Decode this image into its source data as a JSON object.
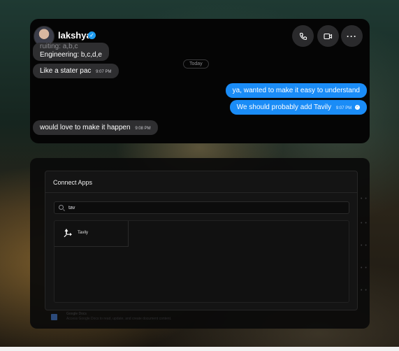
{
  "chat": {
    "contact_name": "lakshya",
    "header_buttons": [
      "phone-icon",
      "video-icon",
      "more-icon"
    ],
    "more_label": "···",
    "messages": [
      {
        "side": "in",
        "text": "Engineering: b,c,d,e",
        "partial_above": "ruiting: a,b,c"
      },
      {
        "side": "in",
        "text": "Like a stater pac",
        "time": "9:07 PM"
      },
      {
        "side": "out",
        "text": "ya, wanted to make it easy to understand"
      },
      {
        "side": "out",
        "text": "We should probably add Tavily",
        "time": "9:07 PM"
      },
      {
        "side": "in",
        "text": "would love to make it happen",
        "time": "9:08 PM"
      }
    ],
    "day_separator": "Today",
    "colors": {
      "incoming": "#2e2e30",
      "outgoing": "#1a8cf7",
      "verified": "#1d9bf0"
    }
  },
  "connect_apps": {
    "title": "Connect Apps",
    "search": {
      "value": "tav",
      "placeholder": ""
    },
    "results": [
      {
        "name": "Tavily",
        "icon": "tavily-icon"
      }
    ],
    "background_item": {
      "title": "Google Docs",
      "description": "Access Google Docs to read, update, and create document content."
    }
  }
}
